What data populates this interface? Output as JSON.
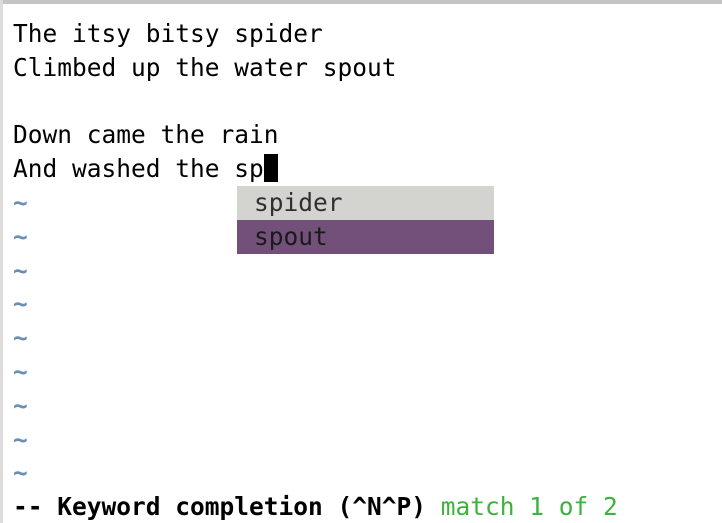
{
  "buffer": {
    "lines": [
      "The itsy bitsy spider",
      "Climbed up the water spout",
      "",
      "Down came the rain",
      "And washed the sp"
    ],
    "empty_line_marker": "~"
  },
  "completion_menu": {
    "items": [
      "spider",
      "spout"
    ],
    "selected_index": 1
  },
  "statusline": {
    "mode": "-- Keyword completion (^N^P)",
    "match": "match 1 of 2"
  },
  "colors": {
    "menu_background": "#d3d4cf",
    "menu_selected_background": "#73507a",
    "tilde": "#6a8fb5",
    "match_text": "#3cb33a"
  }
}
